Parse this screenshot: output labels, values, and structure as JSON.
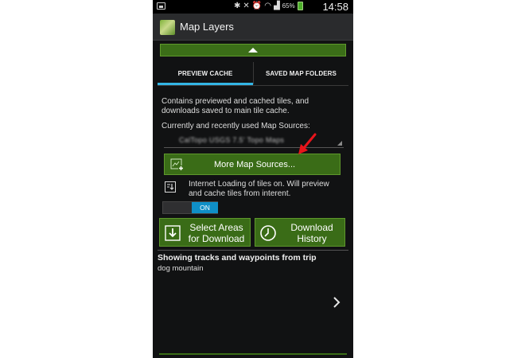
{
  "status_bar": {
    "battery_percent": "65%",
    "time": "14:58"
  },
  "app": {
    "title": "Map Layers"
  },
  "tabs": [
    {
      "label": "PREVIEW CACHE",
      "selected": true
    },
    {
      "label": "SAVED MAP FOLDERS",
      "selected": false
    }
  ],
  "preview_cache": {
    "description": "Contains previewed and cached tiles, and downloads saved to main tile cache.",
    "sources_label": "Currently and recently used Map Sources:",
    "selected_source": "CalTopo USGS 7.5' Topo Maps",
    "more_sources_button": "More Map Sources...",
    "internet_loading_text": "Internet Loading of tiles on. Will preview and cache tiles from interent.",
    "toggle_label": "ON",
    "select_areas_button": "Select Areas for Download",
    "download_history_button": "Download History"
  },
  "tracks": {
    "title": "Showing tracks and waypoints from trip",
    "trip_name": "dog mountain"
  },
  "colors": {
    "button_green": "#3a6c17",
    "tab_accent": "#33b5e5",
    "toggle_blue": "#0f8fc7",
    "annotation_red": "#e8141b",
    "background": "#111213"
  }
}
